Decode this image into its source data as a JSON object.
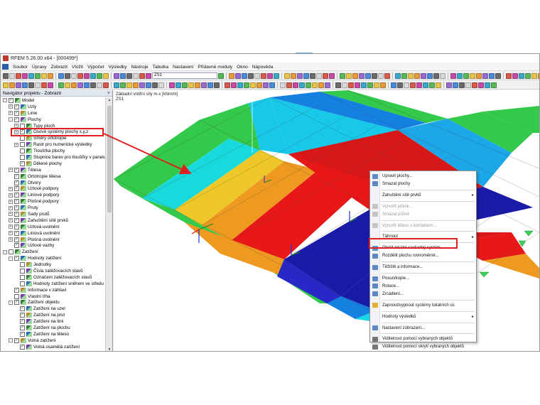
{
  "window": {
    "title": "RFEM 5.26.00 x64 - [000499*]"
  },
  "menu": [
    "Soubor",
    "Úpravy",
    "Zobrazit",
    "Vložit",
    "Výpočet",
    "Výsledky",
    "Nástroje",
    "Tabulka",
    "Nastavení",
    "Přídavné moduly",
    "Okno",
    "Nápověda"
  ],
  "toolbar": {
    "loadcase_combo": "ZS1"
  },
  "navigator": {
    "title": "Navigátor projektu - Zobrazit",
    "close": "×",
    "items": [
      {
        "label": "Model",
        "level": 0,
        "exp": "-",
        "chk": true
      },
      {
        "label": "Uzly",
        "level": 1,
        "exp": "+",
        "chk": true
      },
      {
        "label": "Linie",
        "level": 1,
        "exp": "+",
        "chk": true
      },
      {
        "label": "Plochy",
        "level": 1,
        "exp": "-",
        "chk": true
      },
      {
        "label": "Typy ploch",
        "level": 2,
        "exp": "+",
        "chk": false
      },
      {
        "label": "Osové systémy plochy x,y,z",
        "level": 2,
        "exp": "+",
        "chk": true
      },
      {
        "label": "Směry ortotropie",
        "level": 2,
        "exp": "",
        "chk": false
      },
      {
        "label": "Rastr pro numerické výsledky",
        "level": 2,
        "exp": "+",
        "chk": false
      },
      {
        "label": "Tloušťka plochy",
        "level": 2,
        "exp": "",
        "chk": false
      },
      {
        "label": "Stupnice barev pro tloušťky v panelu",
        "level": 2,
        "exp": "",
        "chk": false
      },
      {
        "label": "Dělené plochy",
        "level": 2,
        "exp": "",
        "chk": true
      },
      {
        "label": "Tělesa",
        "level": 1,
        "exp": "+",
        "chk": true
      },
      {
        "label": "Ortotropie tělesa",
        "level": 1,
        "exp": "",
        "chk": true
      },
      {
        "label": "Otvory",
        "level": 1,
        "exp": "",
        "chk": true
      },
      {
        "label": "Uzlové podpory",
        "level": 1,
        "exp": "+",
        "chk": true
      },
      {
        "label": "Liniové podpory",
        "level": 1,
        "exp": "+",
        "chk": true
      },
      {
        "label": "Plošné podpory",
        "level": 1,
        "exp": "+",
        "chk": true
      },
      {
        "label": "Pruty",
        "level": 1,
        "exp": "+",
        "chk": true
      },
      {
        "label": "Sady prutů",
        "level": 1,
        "exp": "+",
        "chk": true
      },
      {
        "label": "Zahuštění sítě prvků",
        "level": 1,
        "exp": "+",
        "chk": true
      },
      {
        "label": "Uzlová uvolnění",
        "level": 1,
        "exp": "+",
        "chk": true
      },
      {
        "label": "Liniová uvolnění",
        "level": 1,
        "exp": "+",
        "chk": true
      },
      {
        "label": "Plošná uvolnění",
        "level": 1,
        "exp": "+",
        "chk": true
      },
      {
        "label": "Uzlové vazby",
        "level": 1,
        "exp": "",
        "chk": true
      },
      {
        "label": "Zatížení",
        "level": 0,
        "exp": "-",
        "chk": false
      },
      {
        "label": "Hodnoty zatížení",
        "level": 1,
        "exp": "-",
        "chk": true
      },
      {
        "label": "Jednotky",
        "level": 2,
        "exp": "",
        "chk": false
      },
      {
        "label": "Čísla zatěžovacích stavů",
        "level": 2,
        "exp": "",
        "chk": false
      },
      {
        "label": "Označení zatěžovacích stavů",
        "level": 2,
        "exp": "",
        "chk": false
      },
      {
        "label": "Hodnoty zatížení sněhem ve středu p",
        "level": 2,
        "exp": "",
        "chk": false
      },
      {
        "label": "Informace v záhlaví",
        "level": 1,
        "exp": "",
        "chk": true
      },
      {
        "label": "Vlastní tíha",
        "level": 1,
        "exp": "",
        "chk": false
      },
      {
        "label": "Zatížení objektu",
        "level": 1,
        "exp": "-",
        "chk": true
      },
      {
        "label": "Zatížení na uzel",
        "level": 2,
        "exp": "",
        "chk": true
      },
      {
        "label": "Zatížení na prut",
        "level": 2,
        "exp": "",
        "chk": true
      },
      {
        "label": "Zatížení na linii",
        "level": 2,
        "exp": "",
        "chk": true
      },
      {
        "label": "Zatížení na plochu",
        "level": 2,
        "exp": "",
        "chk": true
      },
      {
        "label": "Zatížení na těleso",
        "level": 2,
        "exp": "",
        "chk": true
      },
      {
        "label": "Volná zatížení",
        "level": 1,
        "exp": "-",
        "chk": true
      },
      {
        "label": "Volná osamělá zatížení",
        "level": 2,
        "exp": "",
        "chk": true
      }
    ]
  },
  "viewport": {
    "title": "Základní vnitřní síly m-x [kNm/m]",
    "subtitle": "ZS1"
  },
  "context_menu": {
    "items": [
      {
        "label": "Upravit plochy...",
        "disabled": false,
        "submenu": false,
        "color": "#3b6db3"
      },
      {
        "label": "Smazat plochy",
        "disabled": false,
        "submenu": false,
        "color": "#3b6db3"
      },
      {
        "sep": true
      },
      {
        "label": "Zahuštění sítě prvků",
        "disabled": false,
        "submenu": true,
        "color": ""
      },
      {
        "sep": true
      },
      {
        "label": "Vytvořit průnik...",
        "disabled": true,
        "submenu": false,
        "color": "#b9b9b9"
      },
      {
        "label": "Smazat průnik",
        "disabled": true,
        "submenu": false,
        "color": "#b9b9b9"
      },
      {
        "sep": true
      },
      {
        "label": "Vytvořit těleso s kontaktem...",
        "disabled": true,
        "submenu": false,
        "color": "#b9b9b9"
      },
      {
        "sep": true
      },
      {
        "label": "Táhnout",
        "disabled": false,
        "submenu": true,
        "color": ""
      },
      {
        "sep": true
      },
      {
        "label": "Otočit lokální souřadný systém",
        "disabled": false,
        "submenu": false,
        "color": "#2f7fc1"
      },
      {
        "label": "Rozdělit plochu rovnoměrně...",
        "disabled": false,
        "submenu": false,
        "color": "#3b6db3"
      },
      {
        "sep": true
      },
      {
        "label": "Těžiště a informace...",
        "disabled": false,
        "submenu": false,
        "color": "#3b6db3"
      },
      {
        "sep": true
      },
      {
        "label": "Posun/kopie...",
        "disabled": false,
        "submenu": false,
        "color": "#3b6db3"
      },
      {
        "label": "Rotace...",
        "disabled": false,
        "submenu": false,
        "color": "#3b6db3"
      },
      {
        "label": "Zrcadlení...",
        "disabled": false,
        "submenu": false,
        "color": "#3b6db3"
      },
      {
        "sep": true
      },
      {
        "label": "Zapnout/vypnout systémy lokálních os",
        "disabled": false,
        "submenu": false,
        "color": "#e0a000"
      },
      {
        "sep": true
      },
      {
        "label": "Hodnoty výsledků",
        "disabled": false,
        "submenu": true,
        "color": ""
      },
      {
        "sep": true
      },
      {
        "label": "Nastavení zobrazení...",
        "disabled": false,
        "submenu": false,
        "color": "#3b6db3"
      },
      {
        "sep": true
      },
      {
        "label": "Viditelnost pomocí vybraných objektů",
        "disabled": false,
        "submenu": false,
        "color": "#555555"
      },
      {
        "label": "Viditelnost pomocí skrytí vybraných objektů",
        "disabled": false,
        "submenu": false,
        "color": "#555555"
      }
    ]
  },
  "colors": {
    "accent_red": "#e02020",
    "contour_dark_blue": "#1a1aa8",
    "contour_red": "#dd1010",
    "contour_green": "#28c040",
    "contour_cyan": "#18d8e8"
  }
}
